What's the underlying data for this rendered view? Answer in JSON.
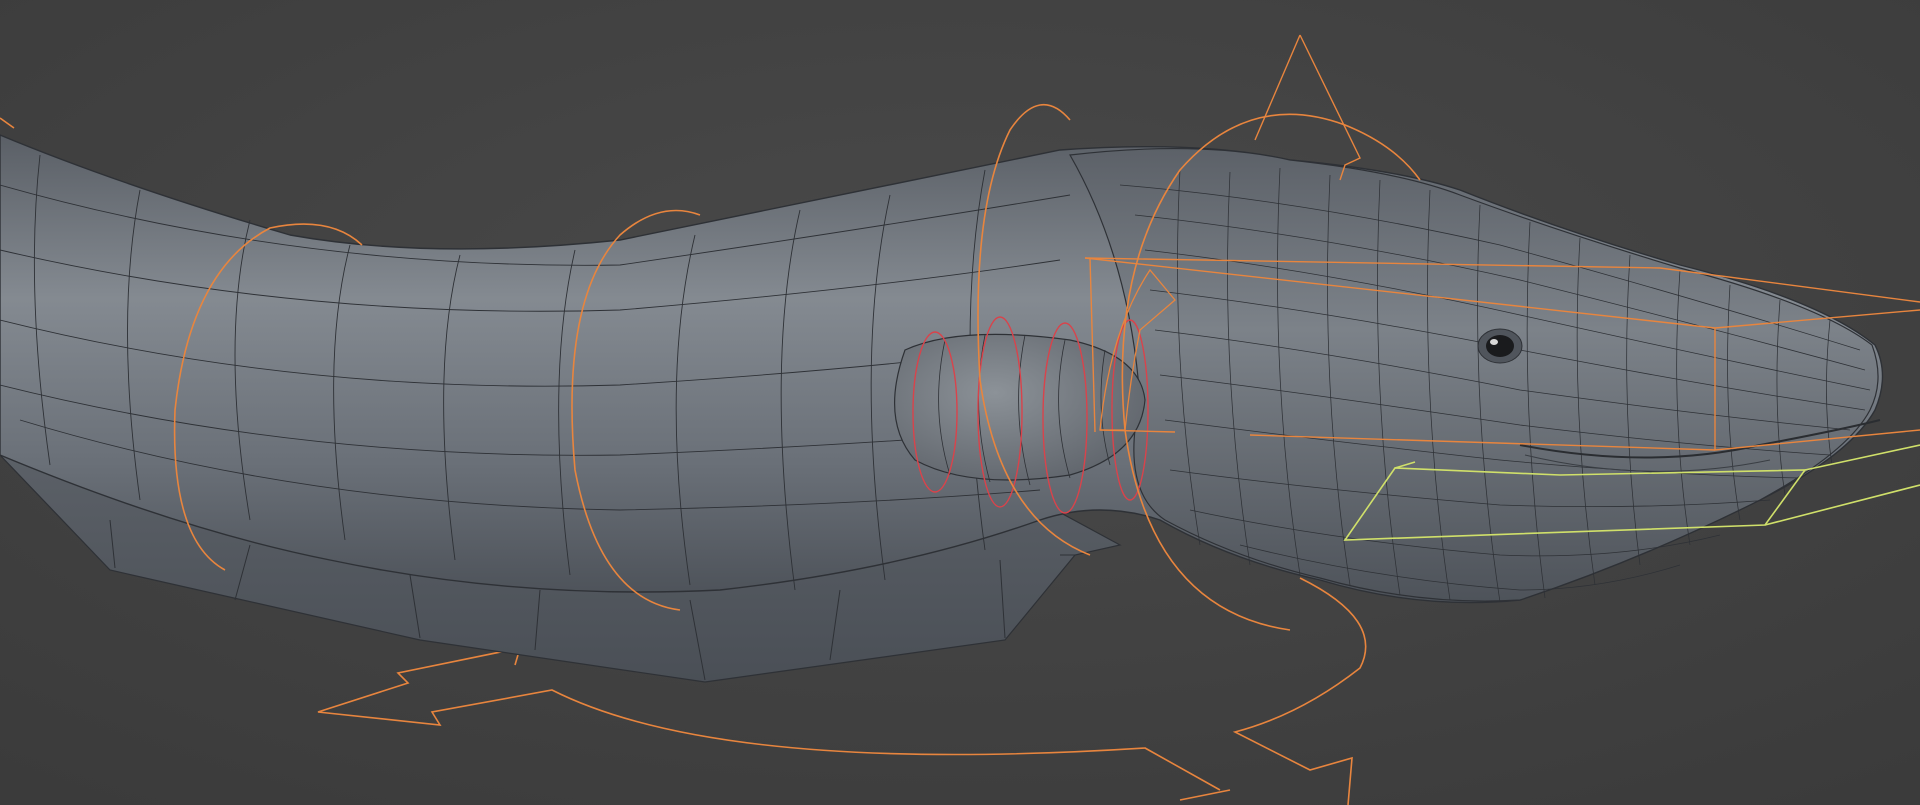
{
  "viewport": {
    "background_color": "#3f3f3f",
    "vignette_color": "#4a4a4a"
  },
  "model": {
    "subject": "eel-body-mesh",
    "body_color": "#6e747c",
    "body_highlight": "#8a9096",
    "body_shadow": "#50555c",
    "wireframe_color": "#2e3136",
    "fin_color": "#5a5f66"
  },
  "rig": {
    "control_color": "#e8853e",
    "selected_control_color": "#d0e06a",
    "fin_control_color": "#d9434b"
  },
  "icons": {
    "eye": "eye-icon"
  }
}
